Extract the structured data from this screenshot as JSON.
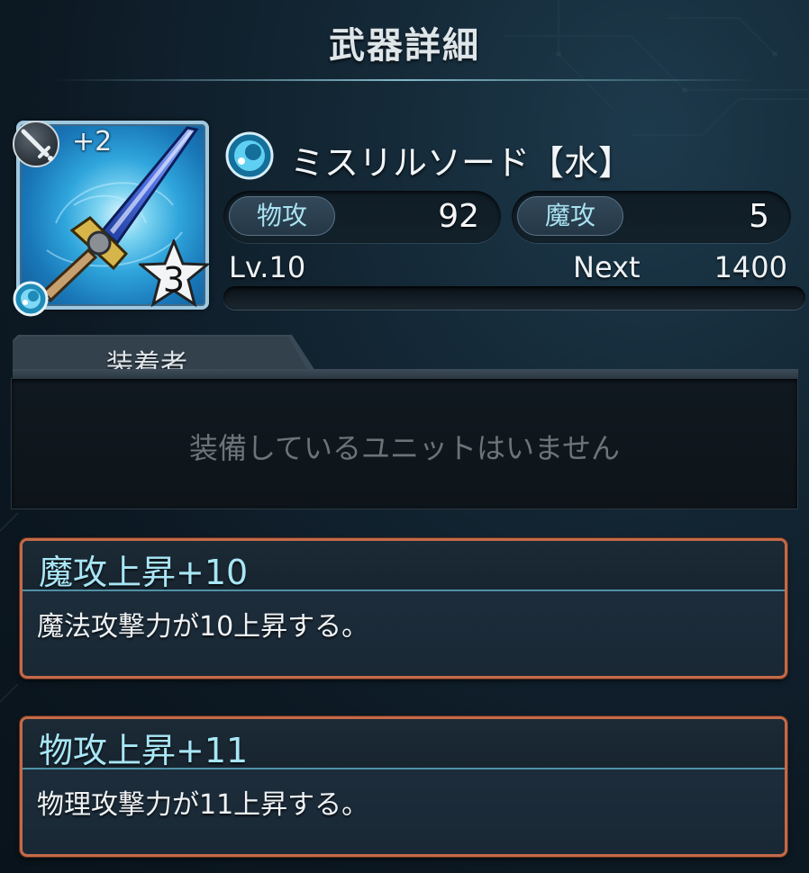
{
  "header": {
    "title": "武器詳細"
  },
  "weapon": {
    "icon": "mythril-sword-icon",
    "plus": "+2",
    "rarity": "3",
    "element": "water",
    "name": "ミスリルソード【水】",
    "type_icon": "sword-icon"
  },
  "stats": {
    "phys_label": "物攻",
    "phys_value": "92",
    "mag_label": "魔攻",
    "mag_value": "5"
  },
  "level": {
    "label": "Lv.10",
    "next_label": "Next",
    "next_value": "1400",
    "progress": 0
  },
  "equipper": {
    "tab_label": "装着者",
    "empty_text": "装備しているユニットはいません"
  },
  "skills": [
    {
      "title": "魔攻上昇+10",
      "description": "魔法攻撃力が10上昇する。"
    },
    {
      "title": "物攻上昇+11",
      "description": "物理攻撃力が11上昇する。"
    }
  ],
  "colors": {
    "accent_cyan": "#a8e6f5",
    "skill_border": "#c46a48",
    "background": "#0c1822"
  }
}
